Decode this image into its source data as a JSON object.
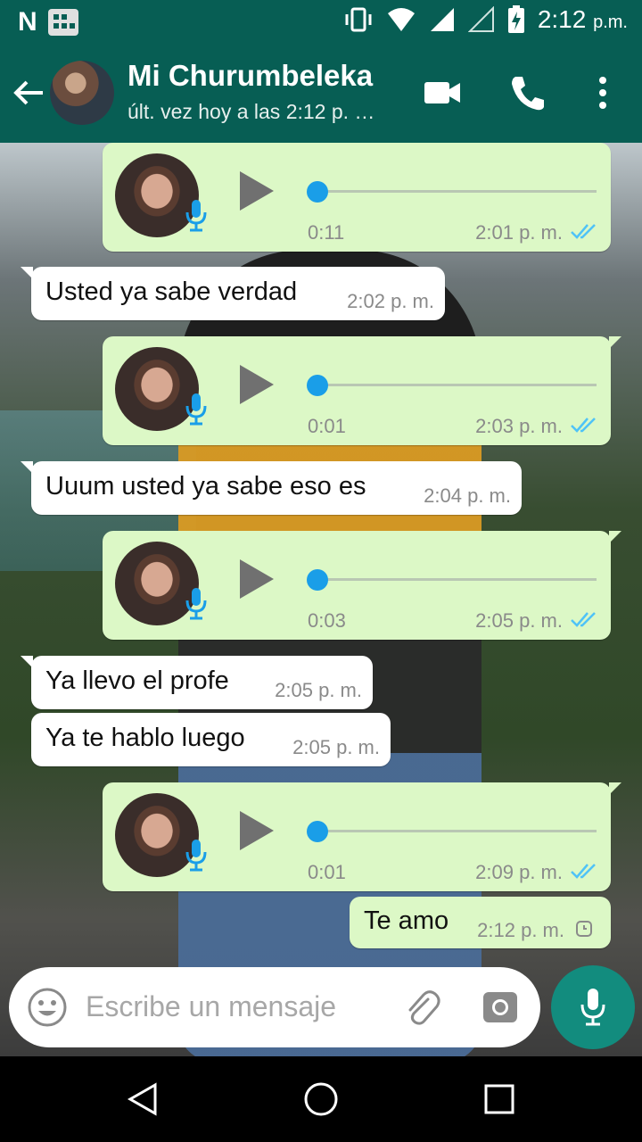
{
  "status_bar": {
    "time": "2:12",
    "time_suffix": "p.m."
  },
  "header": {
    "title": "Mi Churumbeleka",
    "subtitle": "últ. vez hoy a las 2:12 p. …",
    "icons": [
      "back-arrow-icon",
      "video-call-icon",
      "phone-icon",
      "more-vert-icon"
    ]
  },
  "messages": [
    {
      "type": "voice",
      "direction": "out",
      "duration": "0:11",
      "time": "2:01 p. m.",
      "status": "read"
    },
    {
      "type": "text",
      "direction": "in",
      "text": "Usted ya sabe verdad",
      "time": "2:02 p. m."
    },
    {
      "type": "voice",
      "direction": "out",
      "duration": "0:01",
      "time": "2:03 p. m.",
      "status": "read"
    },
    {
      "type": "text",
      "direction": "in",
      "text": "Uuum usted ya sabe eso es",
      "time": "2:04 p. m."
    },
    {
      "type": "voice",
      "direction": "out",
      "duration": "0:03",
      "time": "2:05 p. m.",
      "status": "read"
    },
    {
      "type": "text",
      "direction": "in",
      "text": "Ya llevo el profe",
      "time": "2:05 p. m."
    },
    {
      "type": "text",
      "direction": "in",
      "text": "Ya te hablo luego",
      "time": "2:05 p. m."
    },
    {
      "type": "voice",
      "direction": "out",
      "duration": "0:01",
      "time": "2:09 p. m.",
      "status": "read"
    },
    {
      "type": "text",
      "direction": "out",
      "text": "Te amo",
      "time": "2:12 p. m.",
      "status": "pending"
    }
  ],
  "composer": {
    "placeholder": "Escribe un mensaje"
  },
  "colors": {
    "header": "#075e54",
    "outgoing_bubble": "#dcf8c6",
    "incoming_bubble": "#ffffff",
    "read_ticks": "#4fc3f7",
    "accent_dot": "#1a9ee8",
    "mic_button": "#128c7e"
  }
}
